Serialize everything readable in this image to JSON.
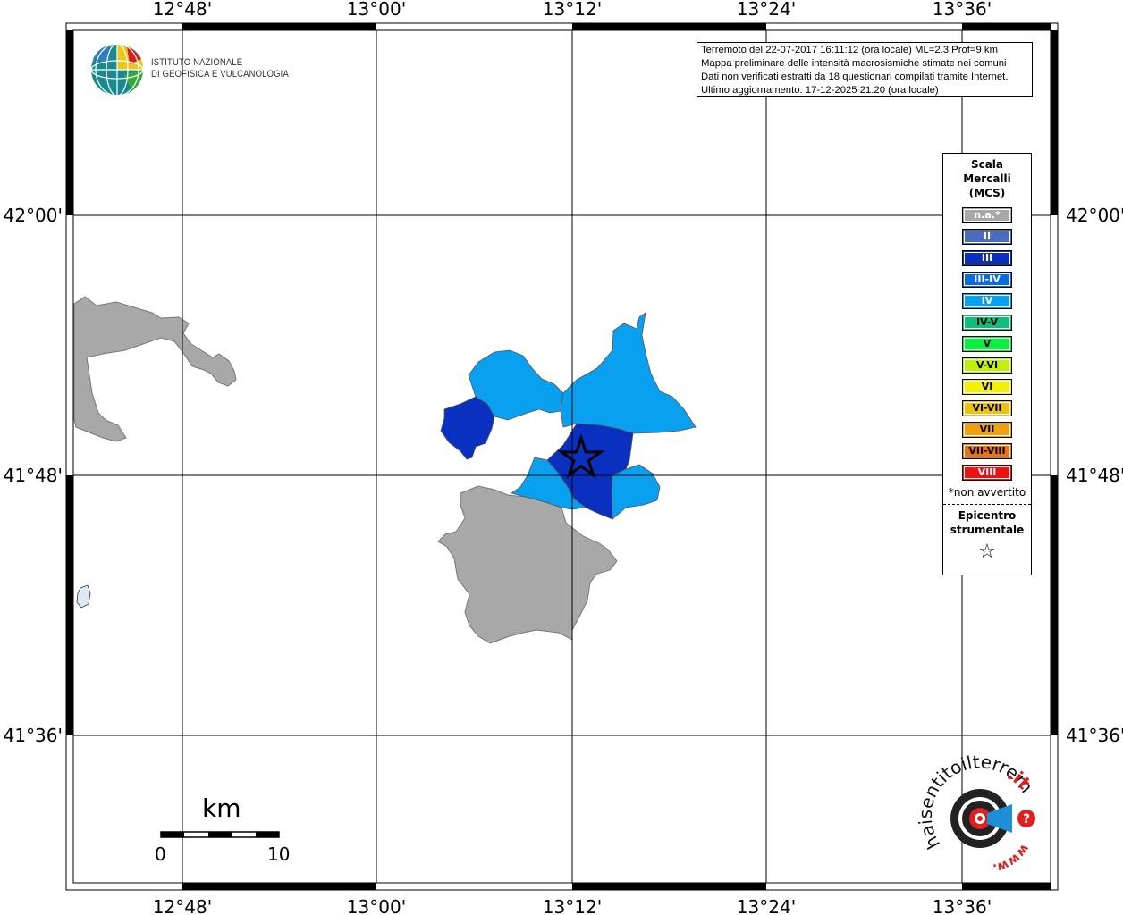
{
  "info": {
    "line1": "Terremoto del 22-07-2017 16:11:12 (ora locale) ML=2.3 Prof=9 km",
    "line2": "Mappa preliminare delle intensità macrosismiche stimate nei comuni",
    "line3": "Dati non verificati estratti da 18 questionari compilati tramite Internet.",
    "line4": "Ultimo aggiornamento: 17-12-2025 21:20 (ora locale)"
  },
  "logo": {
    "line1": "ISTITUTO NAZIONALE",
    "line2": "DI GEOFISICA E VULCANOLOGIA"
  },
  "axes": {
    "lon_labels": [
      "12°48'",
      "13°00'",
      "13°12'",
      "13°24'",
      "13°36'"
    ],
    "lat_labels": [
      "42°00'",
      "41°48'",
      "41°36'"
    ]
  },
  "legend": {
    "title_line1": "Scala",
    "title_line2": "Mercalli",
    "title_line3": "(MCS)",
    "items": [
      {
        "label": "n.a.*",
        "color": "#a8a8a8"
      },
      {
        "label": "II",
        "color": "#4a6cbf"
      },
      {
        "label": "III",
        "color": "#0a30c0"
      },
      {
        "label": "III-IV",
        "color": "#0a6be0"
      },
      {
        "label": "IV",
        "color": "#0aa0f0"
      },
      {
        "label": "IV-V",
        "color": "#0ac07a"
      },
      {
        "label": "V",
        "color": "#0af040"
      },
      {
        "label": "V-VI",
        "color": "#bff00a"
      },
      {
        "label": "VI",
        "color": "#f0f00a"
      },
      {
        "label": "VI-VII",
        "color": "#f0c00a"
      },
      {
        "label": "VII",
        "color": "#f0a00a"
      },
      {
        "label": "VII-VIII",
        "color": "#f0700a"
      },
      {
        "label": "VIII",
        "color": "#f01010"
      }
    ],
    "note": "*non avvertito",
    "epicenter_line1": "Epicentro",
    "epicenter_line2": "strumentale",
    "epicenter_symbol": "☆"
  },
  "scalebar": {
    "unit": "km",
    "start": "0",
    "end": "10"
  },
  "watermark": {
    "text_main": "haisentitoilterremoto",
    "text_suffix": ".it",
    "text_www": "www.",
    "badge": "?"
  },
  "regions": [
    {
      "name": "municipality-gray-northwest",
      "intensity": "n.a.*"
    },
    {
      "name": "municipality-gray-south",
      "intensity": "n.a.*"
    },
    {
      "name": "municipality-west",
      "intensity": "III"
    },
    {
      "name": "municipality-north-west",
      "intensity": "IV"
    },
    {
      "name": "municipality-north-east",
      "intensity": "IV"
    },
    {
      "name": "municipality-epicentral",
      "intensity": "III"
    },
    {
      "name": "municipality-south-west",
      "intensity": "IV"
    },
    {
      "name": "municipality-south-east",
      "intensity": "IV"
    }
  ]
}
